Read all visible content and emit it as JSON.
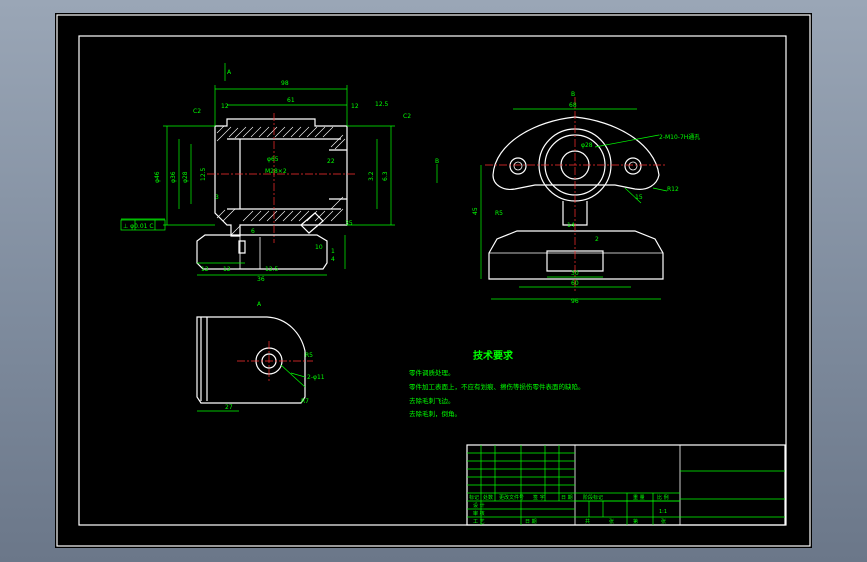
{
  "colors": {
    "background": "#000000",
    "outline": "#ffffff",
    "dimension": "#00ff00",
    "centerline": "#ff3030",
    "window": "#8a96a8"
  },
  "labels": {
    "section_a_top": "A",
    "section_b_right": "B",
    "section_b_top": "B",
    "detail_a": "A"
  },
  "front_dims": {
    "d98": "98",
    "d61": "61",
    "d12a": "12",
    "d12b": "12",
    "c2a": "C2",
    "c2b": "C2",
    "ra12_5a": "12.5",
    "phi46": "φ46",
    "phi36": "φ36",
    "phi28": "φ28",
    "thread": "M28×2",
    "d12_5": "12.5",
    "d3_2": "3.2",
    "d6_3": "6.3",
    "d3": "3",
    "d6": "6",
    "d10": "10",
    "d12c": "12",
    "d36": "36",
    "d12d": "12",
    "ra12_5b": "12.5",
    "d35": "35",
    "d65": "φ65",
    "d22": "22",
    "tolerance_flag": "⊥ φ0.01 C",
    "d4": "4",
    "d1": "1"
  },
  "side_dims": {
    "d68": "68",
    "phi28": "φ28",
    "holes": "2-M10-7H通孔",
    "r12": "R12",
    "d15": "15",
    "d14": "14",
    "d10": "10",
    "d2": "2",
    "d30": "30",
    "d60": "60",
    "d96": "96",
    "h45": "45",
    "rcorner": "R5"
  },
  "detail_dims": {
    "r5": "R5",
    "holes": "2-φ11",
    "r7": "R7",
    "d27": "27"
  },
  "notes": {
    "title": "技术要求",
    "items": [
      "零件调质处理。",
      "零件加工表面上，不应有划痕、擦伤等损伤零件表面的缺陷。",
      "去除毛刺飞边。",
      "去除毛刺，倒角。"
    ]
  },
  "title_block": {
    "r1": [
      "标记",
      "处数",
      "更改文件号",
      "签 字",
      "日 期"
    ],
    "r2": [
      "设 计"
    ],
    "r3": [
      "阶段标记",
      "重 量",
      "比 例"
    ],
    "scale": "1:1",
    "r4": [
      "审 核"
    ],
    "r5": [
      "工 艺",
      "日 期"
    ],
    "r6": [
      "共",
      "张",
      "第",
      "张"
    ]
  }
}
